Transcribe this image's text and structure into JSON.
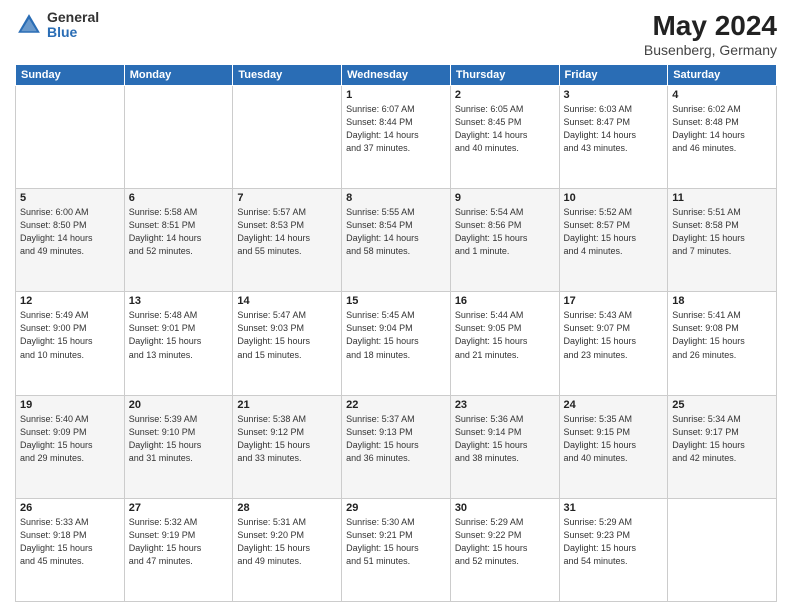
{
  "header": {
    "logo_general": "General",
    "logo_blue": "Blue",
    "month_title": "May 2024",
    "location": "Busenberg, Germany"
  },
  "weekdays": [
    "Sunday",
    "Monday",
    "Tuesday",
    "Wednesday",
    "Thursday",
    "Friday",
    "Saturday"
  ],
  "weeks": [
    [
      {
        "day": "",
        "info": ""
      },
      {
        "day": "",
        "info": ""
      },
      {
        "day": "",
        "info": ""
      },
      {
        "day": "1",
        "info": "Sunrise: 6:07 AM\nSunset: 8:44 PM\nDaylight: 14 hours\nand 37 minutes."
      },
      {
        "day": "2",
        "info": "Sunrise: 6:05 AM\nSunset: 8:45 PM\nDaylight: 14 hours\nand 40 minutes."
      },
      {
        "day": "3",
        "info": "Sunrise: 6:03 AM\nSunset: 8:47 PM\nDaylight: 14 hours\nand 43 minutes."
      },
      {
        "day": "4",
        "info": "Sunrise: 6:02 AM\nSunset: 8:48 PM\nDaylight: 14 hours\nand 46 minutes."
      }
    ],
    [
      {
        "day": "5",
        "info": "Sunrise: 6:00 AM\nSunset: 8:50 PM\nDaylight: 14 hours\nand 49 minutes."
      },
      {
        "day": "6",
        "info": "Sunrise: 5:58 AM\nSunset: 8:51 PM\nDaylight: 14 hours\nand 52 minutes."
      },
      {
        "day": "7",
        "info": "Sunrise: 5:57 AM\nSunset: 8:53 PM\nDaylight: 14 hours\nand 55 minutes."
      },
      {
        "day": "8",
        "info": "Sunrise: 5:55 AM\nSunset: 8:54 PM\nDaylight: 14 hours\nand 58 minutes."
      },
      {
        "day": "9",
        "info": "Sunrise: 5:54 AM\nSunset: 8:56 PM\nDaylight: 15 hours\nand 1 minute."
      },
      {
        "day": "10",
        "info": "Sunrise: 5:52 AM\nSunset: 8:57 PM\nDaylight: 15 hours\nand 4 minutes."
      },
      {
        "day": "11",
        "info": "Sunrise: 5:51 AM\nSunset: 8:58 PM\nDaylight: 15 hours\nand 7 minutes."
      }
    ],
    [
      {
        "day": "12",
        "info": "Sunrise: 5:49 AM\nSunset: 9:00 PM\nDaylight: 15 hours\nand 10 minutes."
      },
      {
        "day": "13",
        "info": "Sunrise: 5:48 AM\nSunset: 9:01 PM\nDaylight: 15 hours\nand 13 minutes."
      },
      {
        "day": "14",
        "info": "Sunrise: 5:47 AM\nSunset: 9:03 PM\nDaylight: 15 hours\nand 15 minutes."
      },
      {
        "day": "15",
        "info": "Sunrise: 5:45 AM\nSunset: 9:04 PM\nDaylight: 15 hours\nand 18 minutes."
      },
      {
        "day": "16",
        "info": "Sunrise: 5:44 AM\nSunset: 9:05 PM\nDaylight: 15 hours\nand 21 minutes."
      },
      {
        "day": "17",
        "info": "Sunrise: 5:43 AM\nSunset: 9:07 PM\nDaylight: 15 hours\nand 23 minutes."
      },
      {
        "day": "18",
        "info": "Sunrise: 5:41 AM\nSunset: 9:08 PM\nDaylight: 15 hours\nand 26 minutes."
      }
    ],
    [
      {
        "day": "19",
        "info": "Sunrise: 5:40 AM\nSunset: 9:09 PM\nDaylight: 15 hours\nand 29 minutes."
      },
      {
        "day": "20",
        "info": "Sunrise: 5:39 AM\nSunset: 9:10 PM\nDaylight: 15 hours\nand 31 minutes."
      },
      {
        "day": "21",
        "info": "Sunrise: 5:38 AM\nSunset: 9:12 PM\nDaylight: 15 hours\nand 33 minutes."
      },
      {
        "day": "22",
        "info": "Sunrise: 5:37 AM\nSunset: 9:13 PM\nDaylight: 15 hours\nand 36 minutes."
      },
      {
        "day": "23",
        "info": "Sunrise: 5:36 AM\nSunset: 9:14 PM\nDaylight: 15 hours\nand 38 minutes."
      },
      {
        "day": "24",
        "info": "Sunrise: 5:35 AM\nSunset: 9:15 PM\nDaylight: 15 hours\nand 40 minutes."
      },
      {
        "day": "25",
        "info": "Sunrise: 5:34 AM\nSunset: 9:17 PM\nDaylight: 15 hours\nand 42 minutes."
      }
    ],
    [
      {
        "day": "26",
        "info": "Sunrise: 5:33 AM\nSunset: 9:18 PM\nDaylight: 15 hours\nand 45 minutes."
      },
      {
        "day": "27",
        "info": "Sunrise: 5:32 AM\nSunset: 9:19 PM\nDaylight: 15 hours\nand 47 minutes."
      },
      {
        "day": "28",
        "info": "Sunrise: 5:31 AM\nSunset: 9:20 PM\nDaylight: 15 hours\nand 49 minutes."
      },
      {
        "day": "29",
        "info": "Sunrise: 5:30 AM\nSunset: 9:21 PM\nDaylight: 15 hours\nand 51 minutes."
      },
      {
        "day": "30",
        "info": "Sunrise: 5:29 AM\nSunset: 9:22 PM\nDaylight: 15 hours\nand 52 minutes."
      },
      {
        "day": "31",
        "info": "Sunrise: 5:29 AM\nSunset: 9:23 PM\nDaylight: 15 hours\nand 54 minutes."
      },
      {
        "day": "",
        "info": ""
      }
    ]
  ]
}
